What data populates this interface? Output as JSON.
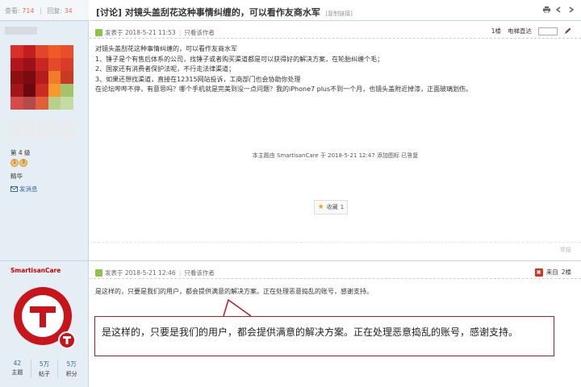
{
  "stats_bar": {
    "view_label": "查看:",
    "view_count": "714",
    "reply_label": "回复:",
    "reply_count": "34"
  },
  "thread": {
    "title": "[讨论] 对镜头盖刮花这种事情纠缠的，可以看作友商水军",
    "copy_link": "[复制链接]"
  },
  "post1": {
    "posted": "发表于 2018-5-21 11:53",
    "author_only": "只看该作者",
    "floor": "1楼",
    "jump_label": "电梯直达",
    "jump_value": "",
    "lines": [
      "对镜头盖刮花这种事情纠缠的，可以看作友商水军",
      "1、锤子是个有售后体系的公司，找锤子或者购买渠道都是可以获得好的解决方案，在轮胎纠缠个毛；",
      "2、国家还有消费者保护法呢，不行走法律渠道；",
      "3、如果还想找渠道，直接在12315网站投诉，工商部门也会协助你处理",
      "在论坛哔哔不停，有意思吗？哪个手机就是完美到没一点问题？我的iPhone7 plus不到一个月，也镜头盖附近掉漆，正面玻璃划伤。"
    ],
    "edit_note": "本主题由 SmartisanCare 于 2018-5-21 12:47 添加图标 已答复",
    "fav_label": "收藏",
    "fav_count": "1",
    "report": "举报"
  },
  "user1": {
    "level": "第 4 级",
    "medals": [
      "1",
      "3"
    ],
    "group": "精华",
    "send_msg": "发消息"
  },
  "post2": {
    "posted": "发表于 2018-5-21 12:46",
    "author_only": "只看该作者",
    "from_label": "来自",
    "floor": "2楼",
    "body": "是这样的，只要是我们的用户，都会提供满意的解决方案。正在处理恶意捣乱的账号，感谢支持。"
  },
  "user2": {
    "name": "SmartisanCare",
    "stats": [
      {
        "value": "42",
        "label": "主题"
      },
      {
        "value": "5万",
        "label": "帖子"
      },
      {
        "value": "5万",
        "label": "积分"
      }
    ]
  },
  "callout": {
    "text": "是这样的，只要是我们的用户，都会提供满意的解决方案。正在处理恶意捣乱的账号，感谢支持。"
  },
  "colors": {
    "accent_red": "#c0191e",
    "link_blue": "#336699",
    "sidebar_bg": "#e6eef5",
    "avatar_red": "#c8141b"
  },
  "icons": [
    "print-icon",
    "prev-icon",
    "next-icon",
    "online-icon",
    "pen-icon",
    "mail-icon",
    "star-icon",
    "phone-icon"
  ]
}
